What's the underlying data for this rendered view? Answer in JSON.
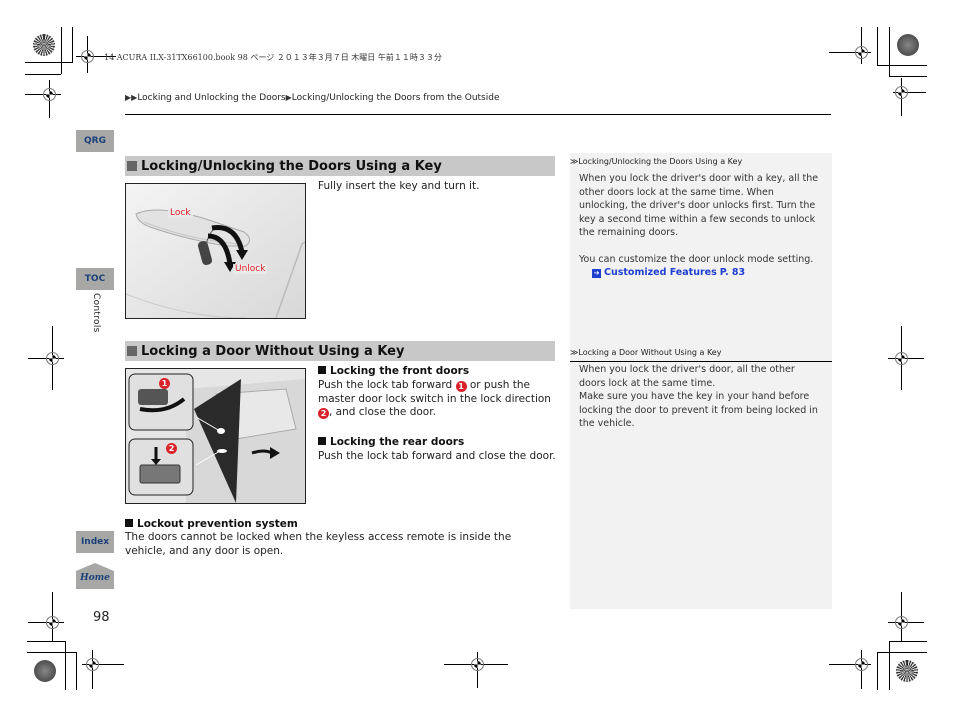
{
  "file_header": "14 ACURA ILX-31TX66100.book  98 ページ  ２０１３年３月７日  木曜日  午前１１時３３分",
  "breadcrumb": {
    "prefix": "▶▶",
    "parts": [
      "Locking and Unlocking the Doors",
      "Locking/Unlocking the Doors from the Outside"
    ],
    "separator": "▶"
  },
  "side_tabs": {
    "qrg": "QRG",
    "toc": "TOC",
    "index": "Index",
    "home": "Home",
    "chapter": "Controls"
  },
  "colors": {
    "tab_bg": "#a7a8a5",
    "tab_text": "#1c3f7a",
    "section_header_bg": "#c8c8c8",
    "callout_red": "#d9232a",
    "link_blue": "#1f3fd0",
    "note_panel_bg": "#f2f2f2"
  },
  "sections": [
    {
      "title": "Locking/Unlocking the Doors Using a Key",
      "body": "Fully insert the key and turn it.",
      "illustration": {
        "icon": "key-in-door-handle-illustration",
        "labels": [
          "Lock",
          "Unlock"
        ]
      }
    },
    {
      "title": "Locking a Door Without Using a Key",
      "illustration": {
        "icon": "open-door-lock-tab-illustration",
        "callouts": [
          "1",
          "2"
        ]
      },
      "subsections": [
        {
          "heading": "Locking the front doors",
          "text_a": "Push the lock tab forward ",
          "callout_a": "1",
          "text_b": " or push the master door lock switch in the lock direction ",
          "callout_b": "2",
          "text_c": ", and close the door."
        },
        {
          "heading": "Locking the rear doors",
          "text": "Push the lock tab forward and close the door."
        }
      ]
    }
  ],
  "lockout": {
    "heading": "Lockout prevention system",
    "text": "The doors cannot be locked when the keyless access remote is inside the vehicle, and any door is open."
  },
  "notes": [
    {
      "title": "Locking/Unlocking the Doors Using a Key",
      "prefix": "≫",
      "paragraph1": "When you lock the driver's door with a key, all the other doors lock at the same time. When unlocking, the driver's door unlocks first. Turn the key a second time within a few seconds to unlock the remaining doors.",
      "paragraph2": "You can customize the door unlock mode setting.",
      "link": {
        "icon": "arrow-link-icon",
        "label": "Customized Features",
        "page": "P. 83"
      }
    },
    {
      "title": "Locking a Door Without Using a Key",
      "prefix": "≫",
      "paragraph1": "When you lock the driver's door, all the other doors lock at the same time.",
      "paragraph2": "Make sure you have the key in your hand before locking the door to prevent it from being locked in the vehicle."
    }
  ],
  "page_number": "98"
}
